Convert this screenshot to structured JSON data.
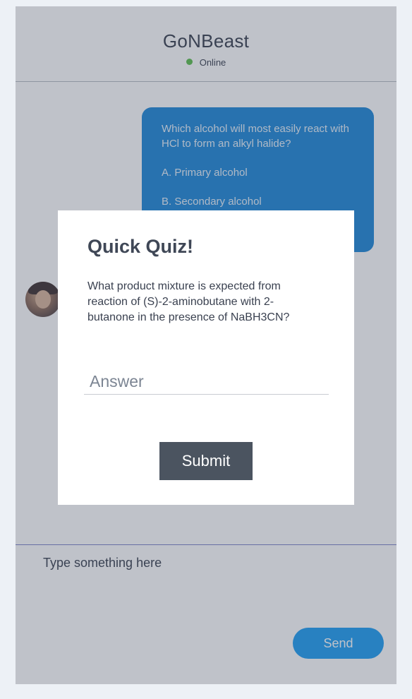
{
  "chat": {
    "title": "GoNBeast",
    "status": "Online",
    "status_color": "#5dbf4e"
  },
  "message": {
    "lines": [
      "Which alcohol will most easily react with HCl to form an alkyl halide?",
      "A. Primary alcohol",
      "B. Secondary alcohol"
    ],
    "bubble_color": "#1e88d8"
  },
  "avatar": {
    "icon": "user-avatar-photo"
  },
  "composer": {
    "placeholder": "Type something here",
    "send_label": "Send",
    "send_color": "#1e9ef4"
  },
  "quiz": {
    "title": "Quick Quiz!",
    "question": "What product mixture is expected from reaction of (S)-2-aminobutane with 2-butanone in the presence of NaBH3CN?",
    "answer_placeholder": "Answer",
    "submit_label": "Submit",
    "submit_color": "#4b5460"
  }
}
